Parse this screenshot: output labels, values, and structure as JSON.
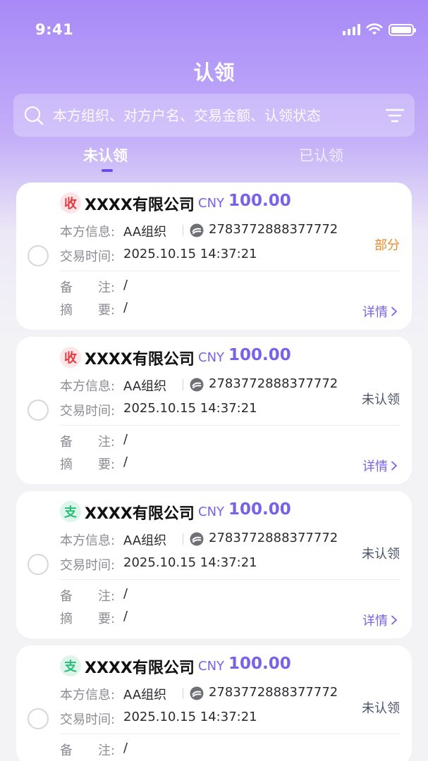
{
  "status_bar": {
    "time": "9:41"
  },
  "header": {
    "title": "认领"
  },
  "search": {
    "placeholder": "本方组织、对方户名、交易金额、认领状态"
  },
  "tabs": [
    {
      "label": "未认领",
      "active": true
    },
    {
      "label": "已认领",
      "active": false
    }
  ],
  "labels": {
    "own_info": "本方信息:",
    "trade_time": "交易时间:",
    "remark": "备　　注:",
    "summary": "摘　　要:",
    "detail": "详情"
  },
  "cards": [
    {
      "type": "收",
      "type_kind": "income",
      "company": "XXXX有限公司",
      "currency": "CNY",
      "amount": "100.00",
      "org": "AA组织",
      "account": "2783772888377772",
      "time": "2025.10.15 14:37:21",
      "status": "部分",
      "status_kind": "partial",
      "remark": "/",
      "summary": "/"
    },
    {
      "type": "收",
      "type_kind": "income",
      "company": "XXXX有限公司",
      "currency": "CNY",
      "amount": "100.00",
      "org": "AA组织",
      "account": "2783772888377772",
      "time": "2025.10.15 14:37:21",
      "status": "未认领",
      "status_kind": "unclaimed",
      "remark": "/",
      "summary": "/"
    },
    {
      "type": "支",
      "type_kind": "expense",
      "company": "XXXX有限公司",
      "currency": "CNY",
      "amount": "100.00",
      "org": "AA组织",
      "account": "2783772888377772",
      "time": "2025.10.15 14:37:21",
      "status": "未认领",
      "status_kind": "unclaimed",
      "remark": "/",
      "summary": "/"
    },
    {
      "type": "支",
      "type_kind": "expense",
      "company": "XXXX有限公司",
      "currency": "CNY",
      "amount": "100.00",
      "org": "AA组织",
      "account": "2783772888377772",
      "time": "2025.10.15 14:37:21",
      "status": "未认领",
      "status_kind": "unclaimed",
      "remark": "/",
      "summary": "/"
    }
  ],
  "colors": {
    "accent": "#7a62e8",
    "income": "#e23c42",
    "expense": "#2bbd7a",
    "partial": "#ea8a28",
    "unclaimed": "#4a5266"
  }
}
